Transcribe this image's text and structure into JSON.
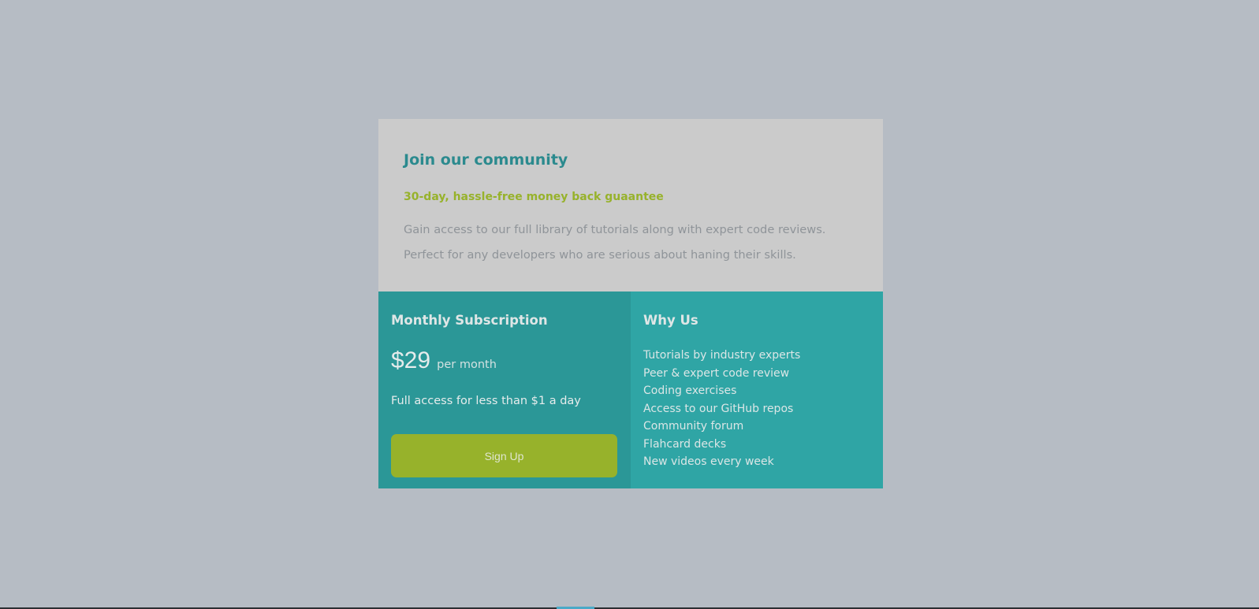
{
  "card": {
    "title": "Join our community",
    "guarantee": "30-day, hassle-free money back guaantee",
    "description": "Gain access to our full library of tutorials along with expert code reviews. Perfect for any developers who are serious about haning their skills."
  },
  "subscription": {
    "heading": "Monthly Subscription",
    "price": "$29",
    "period": "per month",
    "access_text": "Full access for less than $1 a day",
    "signup_label": "Sign Up"
  },
  "why_us": {
    "heading": "Why Us",
    "items": [
      "Tutorials by industry experts",
      "Peer & expert code review",
      "Coding exercises",
      "Access to our GitHub repos",
      "Community forum",
      "Flahcard decks",
      "New videos every week"
    ]
  },
  "colors": {
    "page_background": "#b6bcc4",
    "top_panel": "#cbcbcb",
    "title_teal": "#2b8a8e",
    "guarantee_green": "#97b22b",
    "left_column": "#2b9797",
    "right_column": "#2fa5a5",
    "button": "#97b22b"
  }
}
